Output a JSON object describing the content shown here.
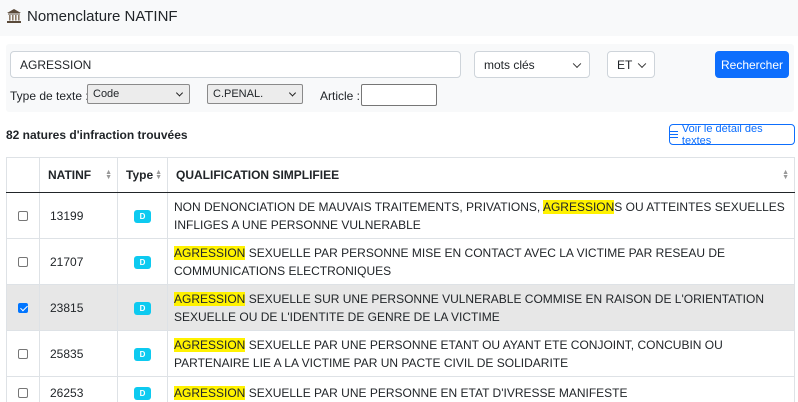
{
  "header": {
    "title": "Nomenclature NATINF",
    "icon": "bank-icon"
  },
  "search": {
    "query": "AGRESSION",
    "mode": "mots clés",
    "operator": "ET",
    "submit_label": "Rechercher",
    "type_label": "Type de texte :",
    "type_value": "Code",
    "code_value": "C.PENAL.",
    "article_label": "Article :",
    "article_value": ""
  },
  "results": {
    "count_text": "82 natures d'infraction trouvées",
    "details_button": "Voir le détail des textes"
  },
  "table": {
    "columns": [
      "NATINF",
      "Type",
      "QUALIFICATION SIMPLIFIEE"
    ],
    "highlight_color": "#fff200",
    "rows": [
      {
        "natinf": "13199",
        "type": "D",
        "checked": false,
        "pre": "NON DENONCIATION DE MAUVAIS TRAITEMENTS, PRIVATIONS, ",
        "match": "AGRESSION",
        "post": "S OU ATTEINTES SEXUELLES INFLIGES A UNE PERSONNE VULNERABLE"
      },
      {
        "natinf": "21707",
        "type": "D",
        "checked": false,
        "pre": "",
        "match": "AGRESSION",
        "post": " SEXUELLE PAR PERSONNE MISE EN CONTACT AVEC LA VICTIME PAR RESEAU DE COMMUNICATIONS ELECTRONIQUES"
      },
      {
        "natinf": "23815",
        "type": "D",
        "checked": true,
        "pre": "",
        "match": "AGRESSION",
        "post": " SEXUELLE SUR UNE PERSONNE VULNERABLE COMMISE EN RAISON DE L'ORIENTATION SEXUELLE OU DE L'IDENTITE DE GENRE DE LA VICTIME"
      },
      {
        "natinf": "25835",
        "type": "D",
        "checked": false,
        "pre": "",
        "match": "AGRESSION",
        "post": " SEXUELLE PAR UNE PERSONNE ETANT OU AYANT ETE CONJOINT, CONCUBIN OU PARTENAIRE LIE A LA VICTIME PAR UN PACTE CIVIL DE SOLIDARITE"
      },
      {
        "natinf": "26253",
        "type": "D",
        "checked": false,
        "pre": "",
        "match": "AGRESSION",
        "post": " SEXUELLE PAR UNE PERSONNE EN ETAT D'IVRESSE MANIFESTE"
      }
    ]
  },
  "colors": {
    "primary": "#0d6efd",
    "badge": "#0dcaf0",
    "selected_row": "#e7e7e7"
  }
}
